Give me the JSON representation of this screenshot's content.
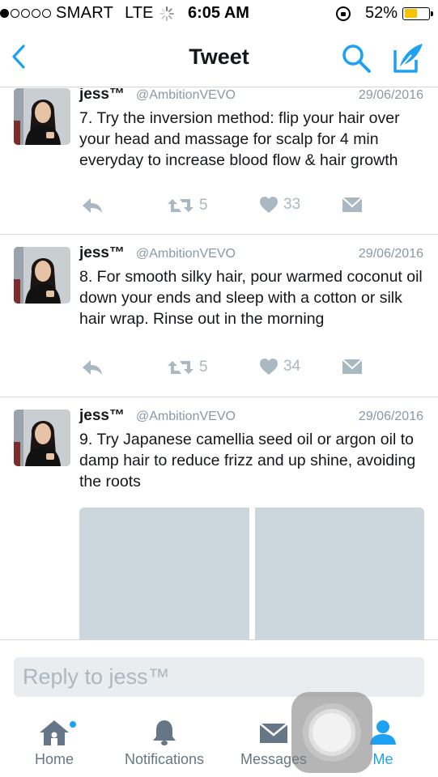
{
  "status_bar": {
    "carrier": "SMART",
    "network": "LTE",
    "time": "6:05 AM",
    "battery_percent": "52%",
    "battery_level": 0.52,
    "signal_dots_filled": 1,
    "signal_dots_total": 5
  },
  "nav": {
    "title": "Tweet",
    "back_icon": "chevron-left-icon",
    "search_icon": "search-icon",
    "compose_icon": "compose-tweet-icon"
  },
  "tweets": [
    {
      "name": "jess™",
      "handle": "@AmbitionVEVO",
      "date": "29/06/2016",
      "text": "7. Try the inversion method: flip your hair over your head and massage for scalp for 4 min everyday to increase blood flow & hair growth",
      "retweets": "5",
      "likes": "33"
    },
    {
      "name": "jess™",
      "handle": "@AmbitionVEVO",
      "date": "29/06/2016",
      "text": "8. For smooth silky hair, pour warmed coconut oil down your ends and sleep with a cotton or silk hair wrap. Rinse out in the morning",
      "retweets": "5",
      "likes": "34"
    },
    {
      "name": "jess™",
      "handle": "@AmbitionVEVO",
      "date": "29/06/2016",
      "text": "9. Try Japanese camellia seed oil or argon oil to damp hair to reduce frizz and up shine, avoiding the roots"
    }
  ],
  "reply": {
    "placeholder": "Reply to jess™"
  },
  "tabs": {
    "home": "Home",
    "notifications": "Notifications",
    "messages": "Messages",
    "me": "Me"
  },
  "colors": {
    "accent": "#1da1f2",
    "muted": "#8899a6",
    "action_gray": "#aab8c2",
    "media_placeholder": "#ccd6dd"
  }
}
